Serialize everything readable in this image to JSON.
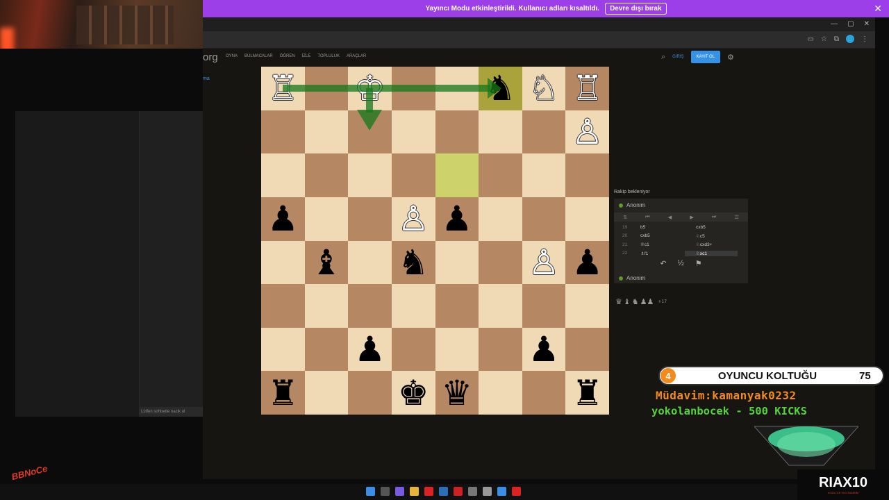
{
  "notice": {
    "message": "Yayıncı Modu etkinleştirildi. Kullanıcı adları kısaltıldı.",
    "button": "Devre dışı bırak"
  },
  "site": {
    "brand": "org",
    "link": "ma",
    "nav": [
      "OYNA",
      "BULMACALAR",
      "ÖĞREN",
      "İZLE",
      "TOPLULUK",
      "ARAÇLAR"
    ],
    "login": "GİRİŞ",
    "register": "KAYIT OL"
  },
  "chat": {
    "hint": "Lütfen sohbette nazik ol"
  },
  "board": {
    "squares": [
      [
        "wr",
        "",
        "wk",
        "",
        "",
        "bn",
        "wn",
        "wr"
      ],
      [
        "",
        "",
        "",
        "",
        "",
        "",
        "",
        "wp"
      ],
      [
        "",
        "",
        "",
        "",
        "",
        "",
        "",
        ""
      ],
      [
        "bp",
        "",
        "",
        "wp",
        "bp",
        "",
        "",
        ""
      ],
      [
        "",
        "bb",
        "",
        "bn",
        "",
        "",
        "wp",
        "bp"
      ],
      [
        "",
        "",
        "",
        "",
        "",
        "",
        "",
        ""
      ],
      [
        "",
        "",
        "bp",
        "",
        "",
        "",
        "bp",
        ""
      ],
      [
        "br",
        "",
        "",
        "bk",
        "bq",
        "",
        "",
        "br"
      ]
    ],
    "highlights": [
      [
        0,
        5
      ],
      [
        2,
        4
      ]
    ]
  },
  "game": {
    "waiting": "Rakip bekleniyor",
    "top_player": "Anonim",
    "bottom_player": "Anonim",
    "moves": [
      {
        "n": "19",
        "w": "b5",
        "b": "cxb5"
      },
      {
        "n": "20",
        "w": "cxb5",
        "b": "♘c5"
      },
      {
        "n": "21",
        "w": "♕c1",
        "b": "♘cxd3+"
      },
      {
        "n": "22",
        "w": "♗f1",
        "b": "♘xc1"
      }
    ],
    "captured": "+17"
  },
  "overlay": {
    "rank": "4",
    "title": "OYUNCU KOLTUĞU",
    "score": "75",
    "mudavim": "Müdavim:kamanyak0232",
    "kicks": "yokolanbocek - 500 KICKS"
  },
  "brand_footer": {
    "name": "RIAX10",
    "sub": "KODU İLE %10 İNDİRİM"
  },
  "icons": {
    "piece_map": {
      "wk": "♔",
      "wq": "♕",
      "wr": "♖",
      "wb": "♗",
      "wn": "♘",
      "wp": "♙",
      "bk": "♚",
      "bq": "♛",
      "br": "♜",
      "bb": "♝",
      "bn": "♞",
      "bp": "♟"
    }
  }
}
